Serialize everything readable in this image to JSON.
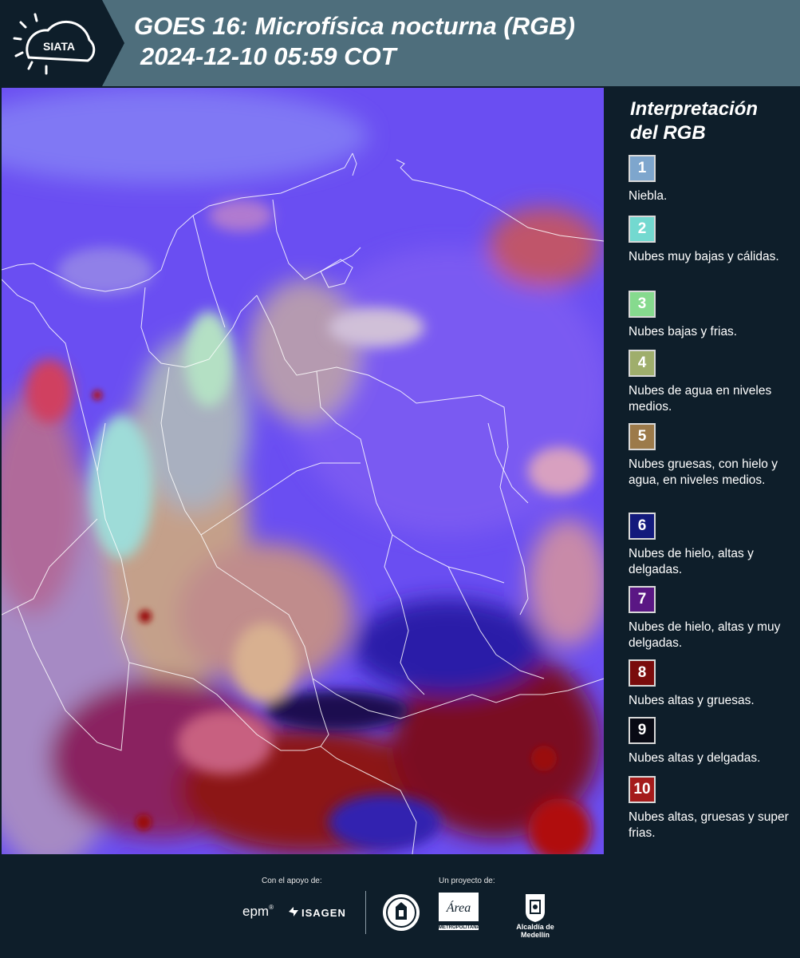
{
  "header": {
    "logo_text": "SIATA",
    "title_line1": "GOES 16: Microfísica nocturna (RGB)",
    "title_line2": "2024-12-10 05:59 COT"
  },
  "legend": {
    "title_line1": "Interpretación",
    "title_line2": "del RGB",
    "items": [
      {
        "num": "1",
        "label": "Niebla.",
        "color": "#7ea6cd"
      },
      {
        "num": "2",
        "label": "Nubes muy bajas y cálidas.",
        "color": "#73d9d0"
      },
      {
        "num": "3",
        "label": "Nubes bajas y frias.",
        "color": "#86da8e"
      },
      {
        "num": "4",
        "label": "Nubes de agua en niveles medios.",
        "color": "#9fae6c"
      },
      {
        "num": "5",
        "label": "Nubes gruesas, con hielo y agua, en niveles medios.",
        "color": "#9c7a4a"
      },
      {
        "num": "6",
        "label": "Nubes de hielo, altas y delgadas.",
        "color": "#131a7c"
      },
      {
        "num": "7",
        "label": "Nubes de hielo, altas y muy delgadas.",
        "color": "#5a1784"
      },
      {
        "num": "8",
        "label": "Nubes altas y gruesas.",
        "color": "#7a0c0c"
      },
      {
        "num": "9",
        "label": "Nubes altas y delgadas.",
        "color": "#080a14"
      },
      {
        "num": "10",
        "label": "Nubes altas, gruesas y super frias.",
        "color": "#a51b1b"
      }
    ]
  },
  "footer": {
    "support_label": "Con el apoyo de:",
    "project_label": "Un proyecto de:",
    "sponsor_epm": "epm",
    "sponsor_isagen": "ISAGEN",
    "partner_metropolitana": "METROPOLITANA",
    "partner_medellin": "Alcaldía de Medellín"
  }
}
